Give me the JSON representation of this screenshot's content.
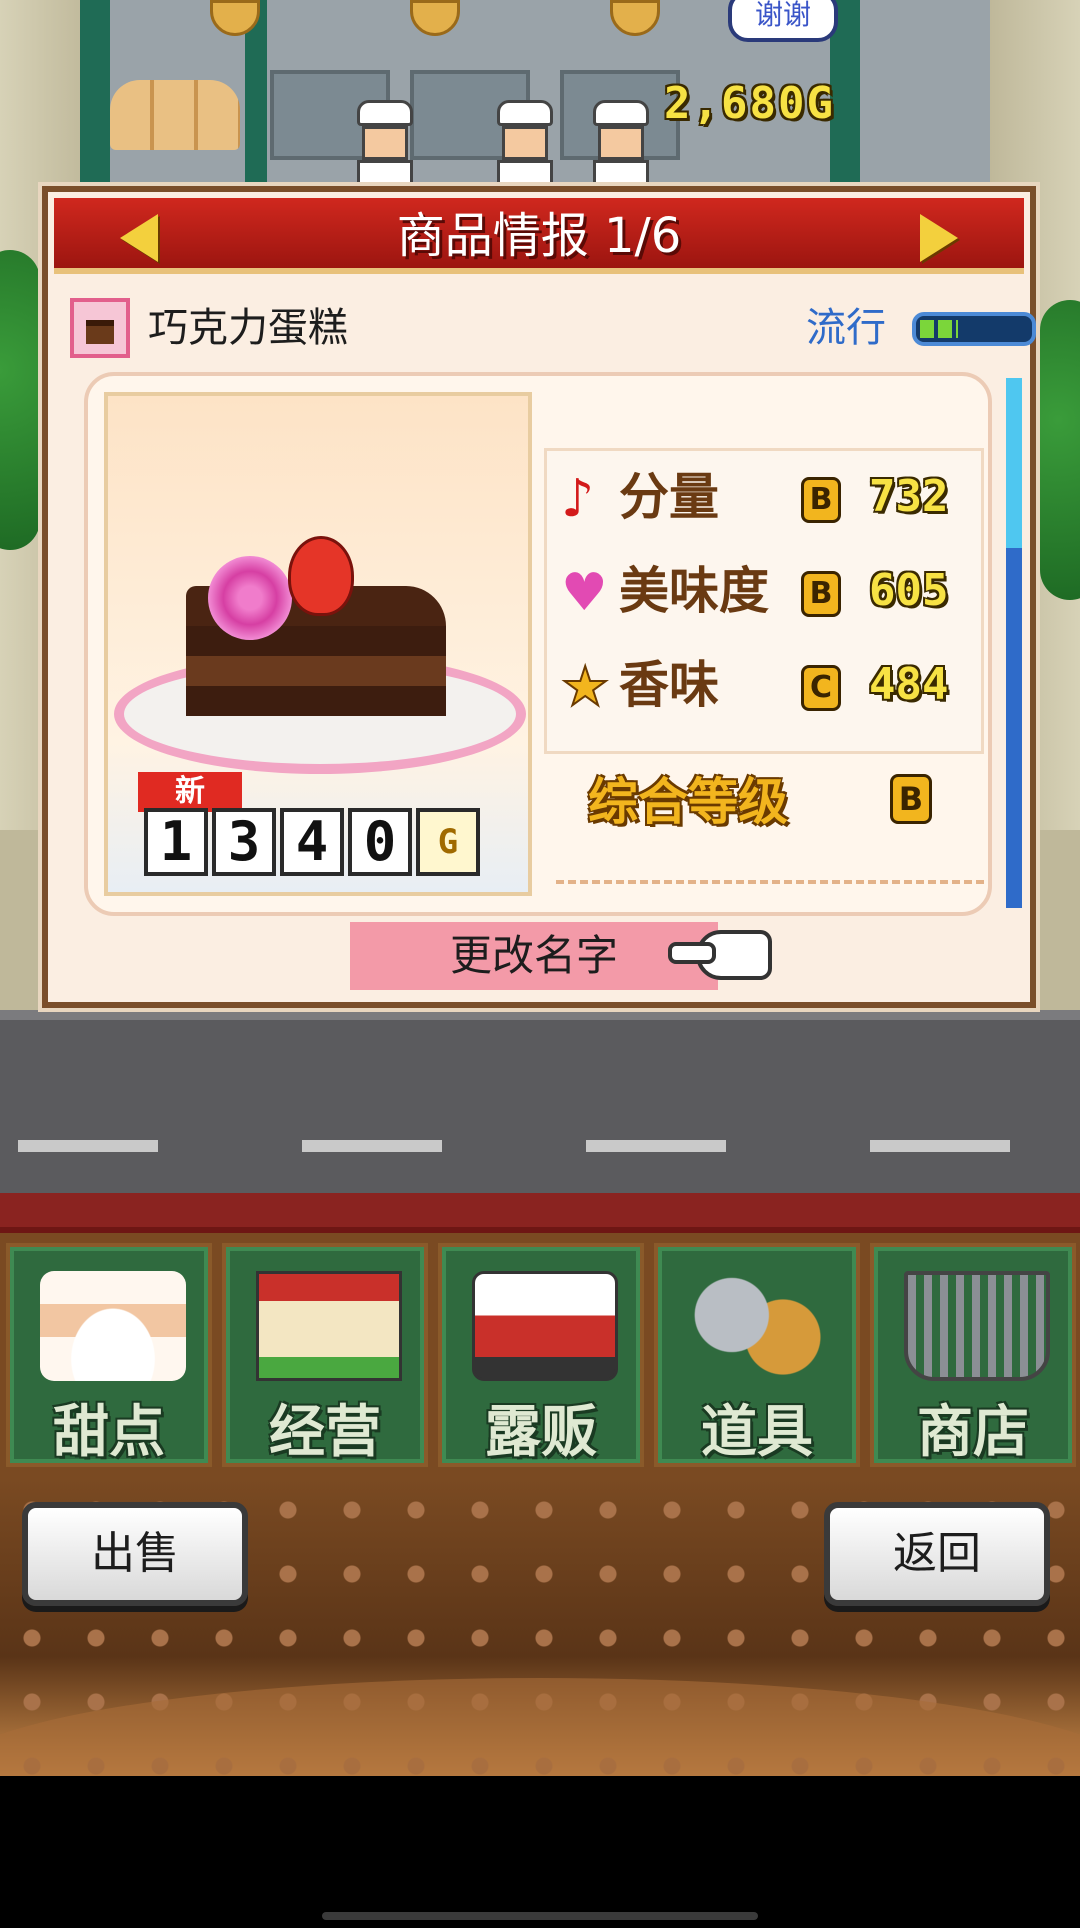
{
  "scene": {
    "speech_bubble": "谢谢",
    "money": "2,680G"
  },
  "dialog": {
    "title": "商品情报 1/6",
    "product_name": "巧克力蛋糕",
    "trend_label": "流行",
    "trend_level": 0.35,
    "price": {
      "new_badge": "新",
      "digits": [
        "1",
        "3",
        "4",
        "0"
      ],
      "currency": "G"
    },
    "stats": [
      {
        "icon": "music-note-icon",
        "label": "分量",
        "rank": "B",
        "value": "732"
      },
      {
        "icon": "heart-icon",
        "label": "美味度",
        "rank": "B",
        "value": "605"
      },
      {
        "icon": "star-icon",
        "label": "香味",
        "rank": "C",
        "value": "484"
      }
    ],
    "overall_label": "综合等级",
    "overall_rank": "B",
    "rename_button": "更改名字"
  },
  "menu": {
    "items": [
      {
        "label": "甜点",
        "icon": "cake-icon"
      },
      {
        "label": "经营",
        "icon": "shop-icon"
      },
      {
        "label": "露贩",
        "icon": "food-truck-icon"
      },
      {
        "label": "道具",
        "icon": "gear-bag-icon"
      },
      {
        "label": "商店",
        "icon": "shopping-cart-icon"
      }
    ]
  },
  "bottom": {
    "sell_button": "出售",
    "back_button": "返回"
  },
  "colors": {
    "header_red": "#c0201a",
    "accent_gold": "#f2b51e",
    "menu_green": "#2f6a3e",
    "trend_blue": "#2f6bc9"
  }
}
